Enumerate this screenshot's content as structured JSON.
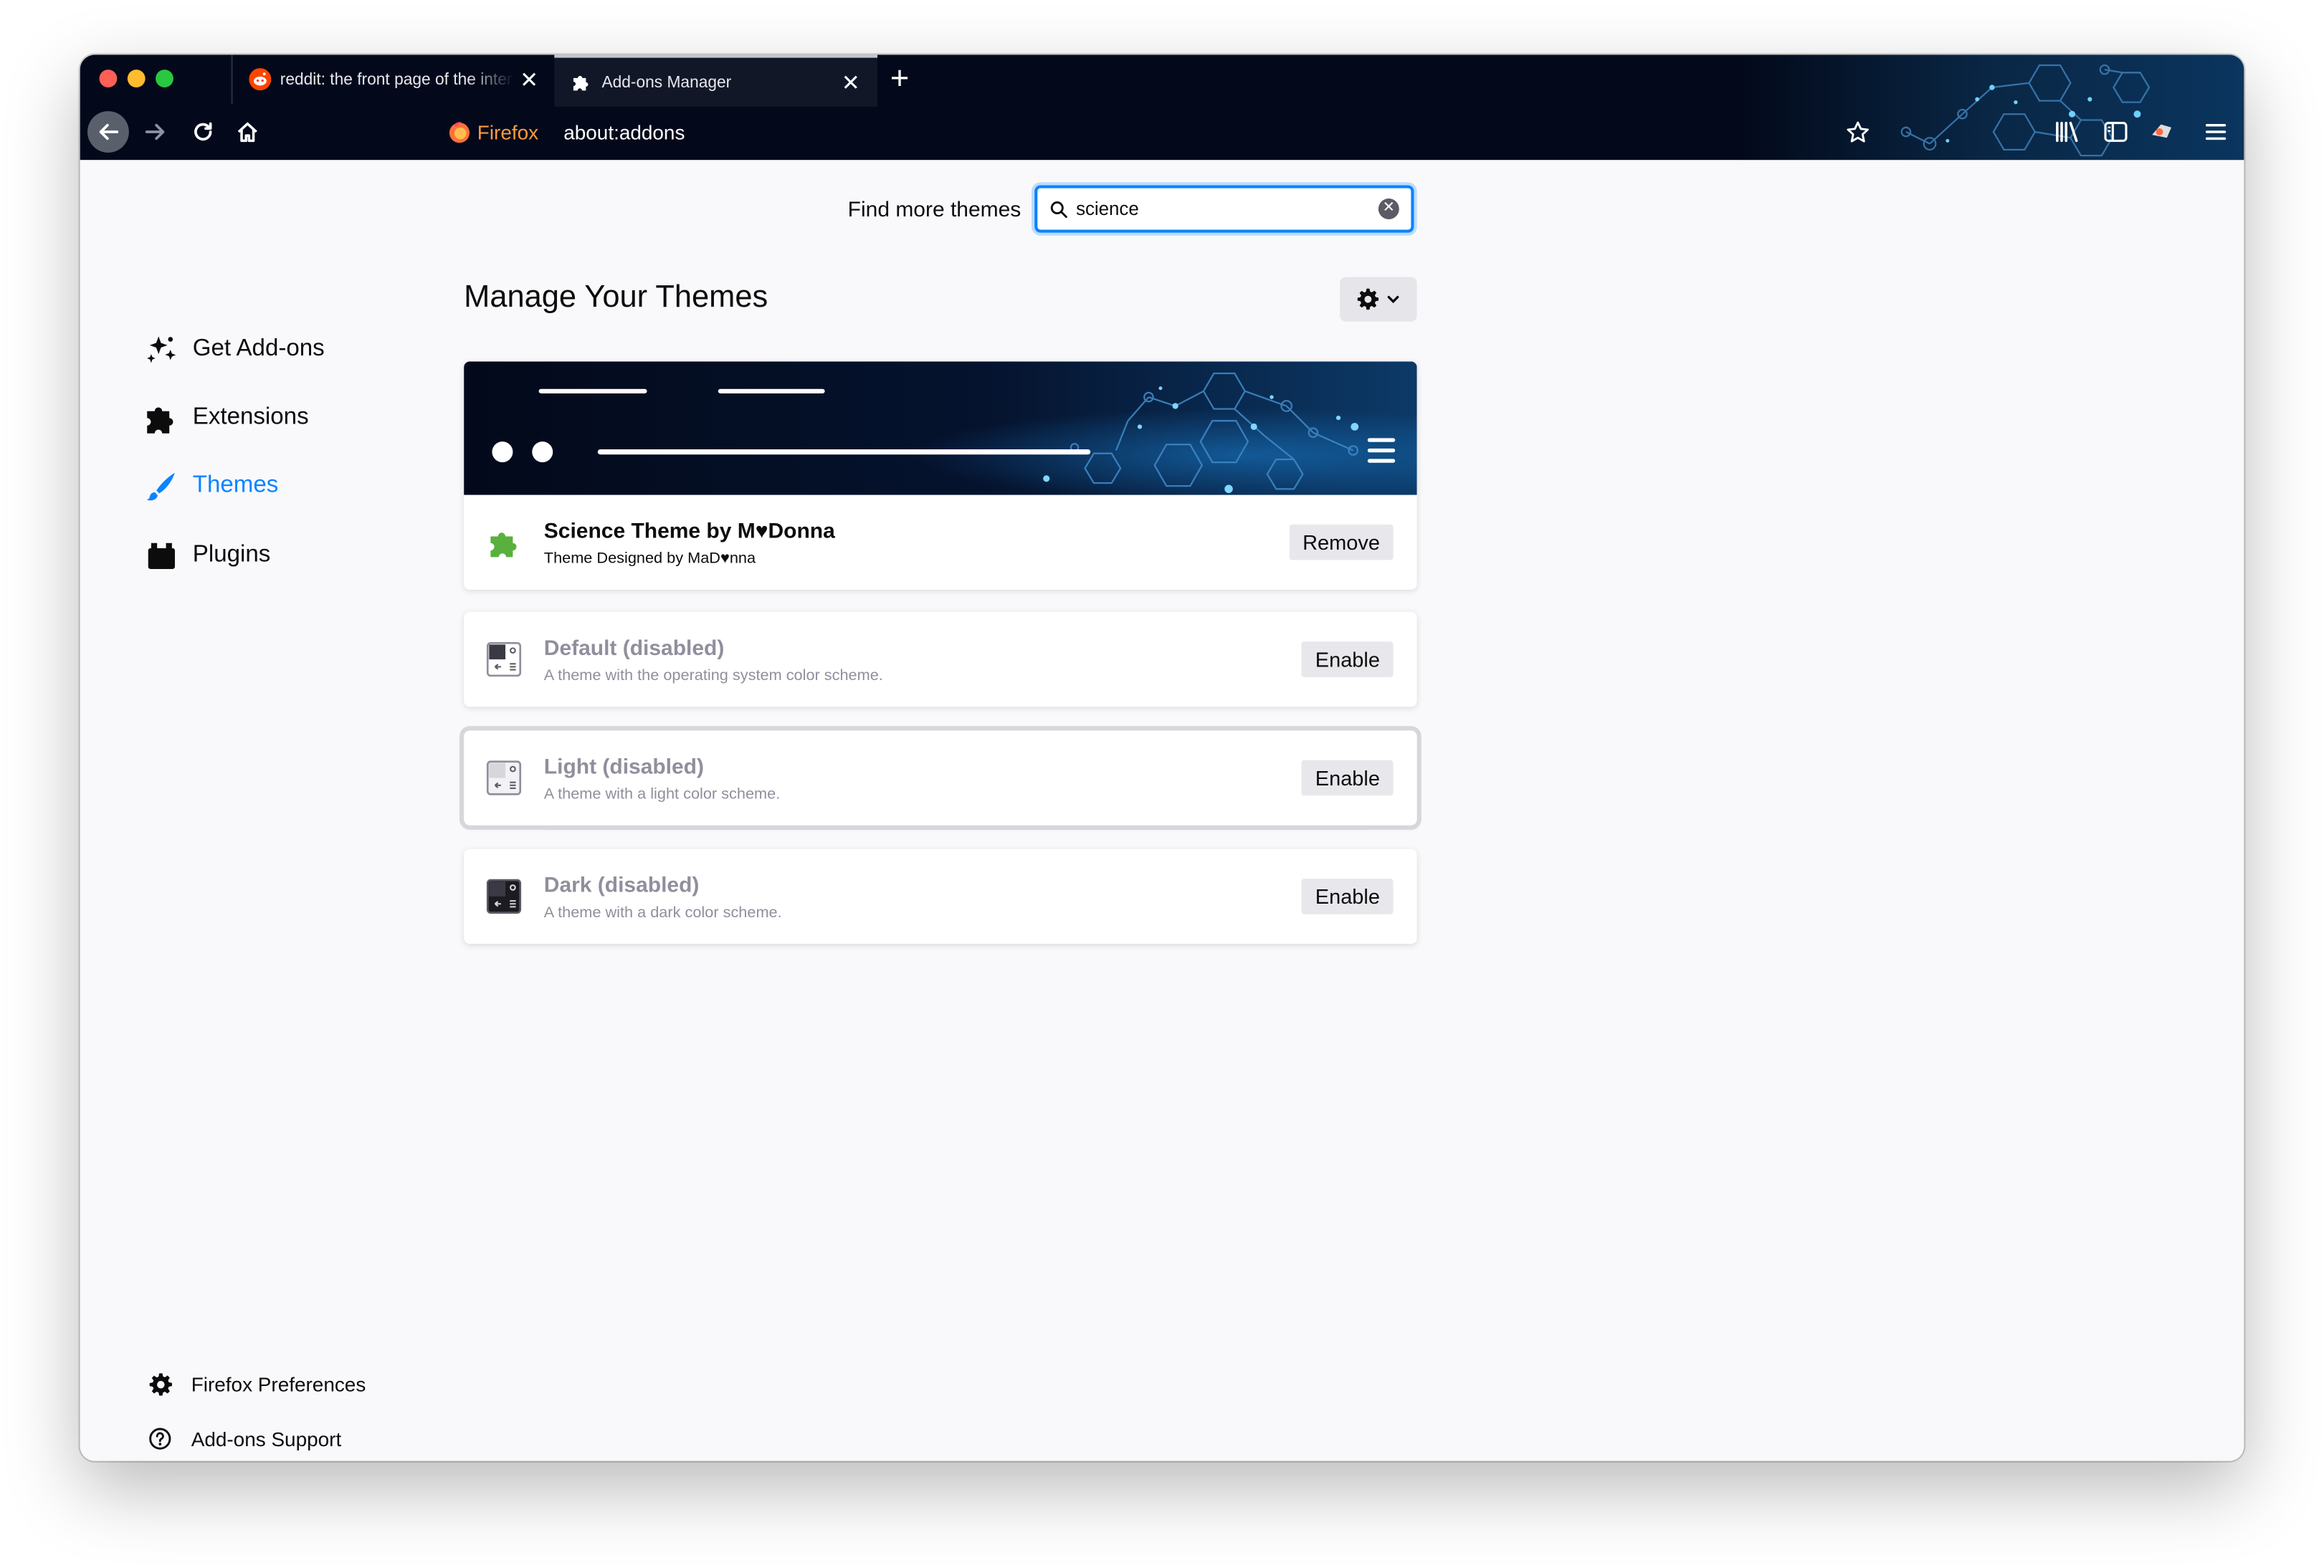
{
  "colors": {
    "accent": "#0a84ff",
    "toolbar_bg": "#03091a",
    "theme_glow": "#1fb4ff",
    "page_bg": "#f9f9fb",
    "disabled_text": "#8f8f9d"
  },
  "tabs": [
    {
      "title": "reddit: the front page of the internet",
      "icon": "reddit-icon",
      "active": false
    },
    {
      "title": "Add-ons Manager",
      "icon": "puzzle-icon",
      "active": true
    }
  ],
  "toolbar": {
    "identity_label": "Firefox",
    "url": "about:addons",
    "new_tab_label": "+"
  },
  "search": {
    "label": "Find more themes",
    "value": "science",
    "placeholder": ""
  },
  "sidebar": {
    "items": [
      {
        "label": "Get Add-ons",
        "icon": "get-addons-icon"
      },
      {
        "label": "Extensions",
        "icon": "puzzle-icon"
      },
      {
        "label": "Themes",
        "icon": "brush-icon",
        "selected": true
      },
      {
        "label": "Plugins",
        "icon": "plugin-icon"
      }
    ],
    "footer": [
      {
        "label": "Firefox Preferences",
        "icon": "gear-icon"
      },
      {
        "label": "Add-ons Support",
        "icon": "help-icon"
      }
    ]
  },
  "main": {
    "title": "Manage Your Themes",
    "themes": [
      {
        "name": "Science Theme by M♥Donna",
        "description": "Theme Designed by MaD♥nna",
        "button": "Remove",
        "enabled": true
      },
      {
        "name": "Default (disabled)",
        "description": "A theme with the operating system color scheme.",
        "button": "Enable",
        "enabled": false
      },
      {
        "name": "Light (disabled)",
        "description": "A theme with a light color scheme.",
        "button": "Enable",
        "enabled": false
      },
      {
        "name": "Dark (disabled)",
        "description": "A theme with a dark color scheme.",
        "button": "Enable",
        "enabled": false
      }
    ]
  }
}
